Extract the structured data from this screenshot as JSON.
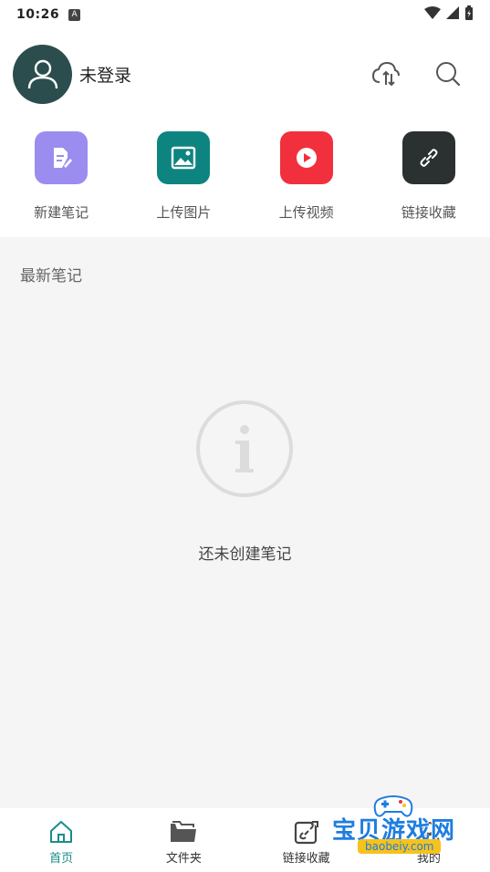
{
  "status_bar": {
    "time": "10:26",
    "notification_glyph": "A"
  },
  "header": {
    "username": "未登录",
    "avatar_color": "#2c4d4e",
    "actions": [
      "cloud-sync-icon",
      "search-icon"
    ]
  },
  "quick_actions": [
    {
      "label": "新建笔记",
      "icon": "note-edit-icon",
      "color": "#9b8cf0"
    },
    {
      "label": "上传图片",
      "icon": "image-icon",
      "color": "#0e8480"
    },
    {
      "label": "上传视频",
      "icon": "play-icon",
      "color": "#f2303d"
    },
    {
      "label": "链接收藏",
      "icon": "link-icon",
      "color": "#2b3131"
    }
  ],
  "notes_section": {
    "title": "最新笔记",
    "empty_text": "还未创建笔记",
    "empty_icon": "info-icon"
  },
  "tabbar": {
    "accent_color": "#1a8c8c",
    "tabs": [
      {
        "label": "首页",
        "icon": "home-icon",
        "active": true
      },
      {
        "label": "文件夹",
        "icon": "folder-icon",
        "active": false
      },
      {
        "label": "链接收藏",
        "icon": "link-edit-icon",
        "active": false
      },
      {
        "label": "我的",
        "icon": "profile-icon",
        "active": false
      }
    ]
  },
  "watermark": {
    "title": "宝贝游戏网",
    "domain": "baobeiy.com"
  }
}
